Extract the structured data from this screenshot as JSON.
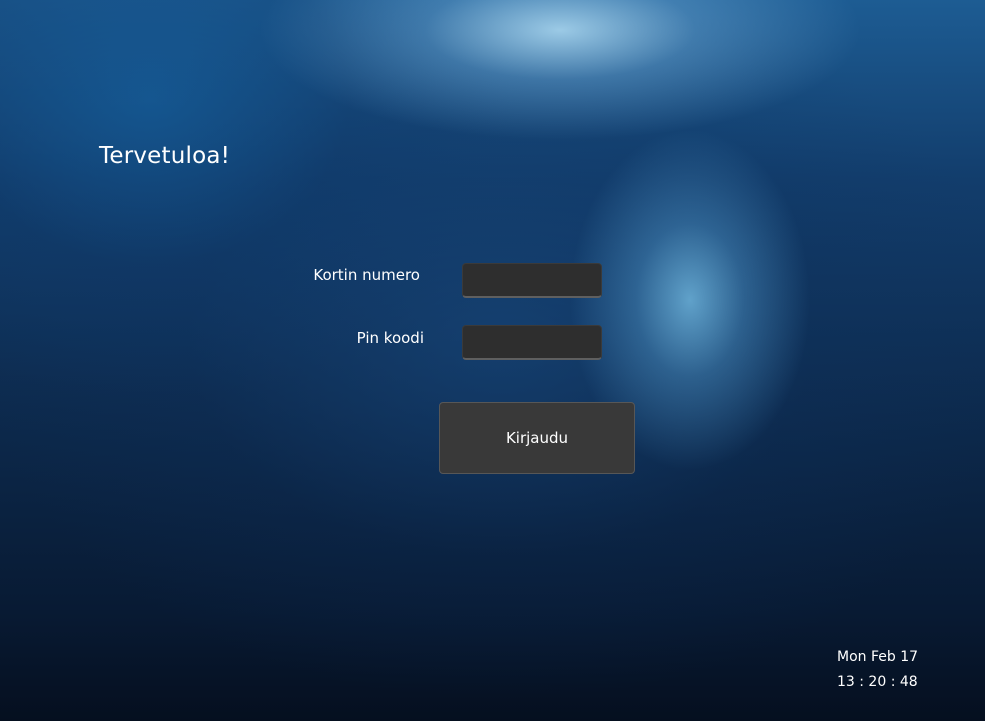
{
  "welcome": {
    "title": "Tervetuloa!"
  },
  "login_form": {
    "card_number_label": "Kortin numero",
    "card_number_value": "",
    "pin_label": "Pin koodi",
    "pin_value": "",
    "login_button_label": "Kirjaudu"
  },
  "clock": {
    "date": "Mon Feb 17",
    "time": "13 : 20 : 48"
  },
  "colors": {
    "field_background": "#2e2e2e",
    "button_background": "#393939",
    "text": "#ffffff"
  }
}
